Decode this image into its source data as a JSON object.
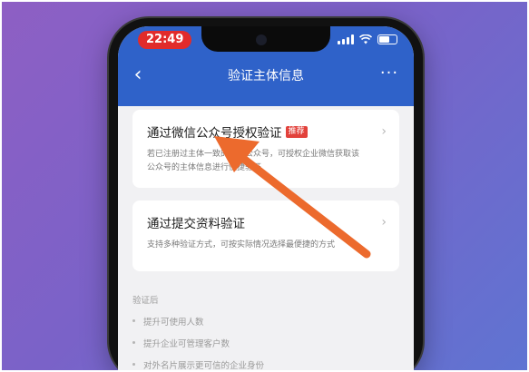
{
  "status": {
    "time": "22:49"
  },
  "navbar": {
    "back_icon": "back-chevron-icon",
    "title": "验证主体信息",
    "more_icon": "more-dots-icon"
  },
  "cards": [
    {
      "title": "通过微信公众号授权验证",
      "tag": "推荐",
      "desc": "若已注册过主体一致的微信公众号，可授权企业微信获取该公众号的主体信息进行快捷验证",
      "chevron_icon": "chevron-right-icon"
    },
    {
      "title": "通过提交资料验证",
      "desc": "支持多种验证方式，可按实际情况选择最便捷的方式",
      "chevron_icon": "chevron-right-icon"
    }
  ],
  "after_verify": {
    "title": "验证后",
    "items": [
      "提升可使用人数",
      "提升企业可管理客户数",
      "对外名片展示更可信的企业身份"
    ]
  },
  "colors": {
    "accent": "#2f62c9",
    "annotation_arrow": "#ec6a2d",
    "tag": "#e2413b",
    "time_pill": "#e12b2b"
  }
}
